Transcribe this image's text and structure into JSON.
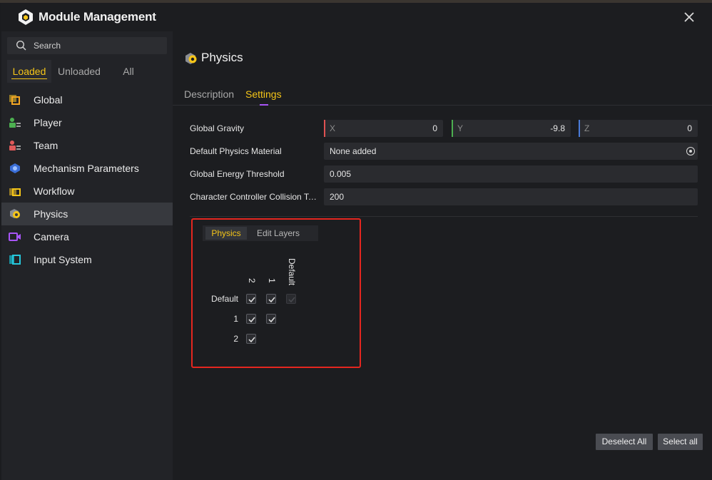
{
  "window": {
    "title": "Module Management",
    "icons": {
      "logo": "app-logo-icon",
      "close": "close-icon"
    }
  },
  "sidebar": {
    "search_placeholder": "Search",
    "filter_tabs": [
      {
        "label": "Loaded",
        "active": true
      },
      {
        "label": "Unloaded",
        "active": false
      },
      {
        "label": "All",
        "active": false
      }
    ],
    "modules": [
      {
        "label": "Global",
        "icon": "global-module-icon",
        "active": false
      },
      {
        "label": "Player",
        "icon": "player-module-icon",
        "active": false
      },
      {
        "label": "Team",
        "icon": "team-module-icon",
        "active": false
      },
      {
        "label": "Mechanism Parameters",
        "icon": "mechanism-module-icon",
        "active": false
      },
      {
        "label": "Workflow",
        "icon": "workflow-module-icon",
        "active": false
      },
      {
        "label": "Physics",
        "icon": "physics-module-icon",
        "active": true
      },
      {
        "label": "Camera",
        "icon": "camera-module-icon",
        "active": false
      },
      {
        "label": "Input System",
        "icon": "input-system-module-icon",
        "active": false
      }
    ]
  },
  "main": {
    "title": "Physics",
    "tabs": [
      {
        "label": "Description",
        "active": false
      },
      {
        "label": "Settings",
        "active": true
      }
    ],
    "settings": {
      "gravity": {
        "label": "Global Gravity",
        "x_placeholder": "X",
        "x": "0",
        "y_placeholder": "Y",
        "y": "-9.8",
        "z_placeholder": "Z",
        "z": "0"
      },
      "material": {
        "label": "Default Physics Material",
        "value": "None added"
      },
      "energy": {
        "label": "Global Energy Threshold",
        "value": "0.005"
      },
      "collision": {
        "label": "Character Controller Collision Tolerance",
        "value": "200"
      }
    },
    "matrix": {
      "tabs": [
        {
          "label": "Physics",
          "active": true
        },
        {
          "label": "Edit Layers",
          "active": false
        }
      ],
      "columns": [
        "2",
        "1",
        "Default"
      ],
      "rows": [
        {
          "label": "Default",
          "cells": [
            true,
            true,
            true
          ],
          "disabled": [
            false,
            false,
            true
          ]
        },
        {
          "label": "1",
          "cells": [
            true,
            true
          ]
        },
        {
          "label": "2",
          "cells": [
            true
          ]
        }
      ]
    },
    "buttons": {
      "deselect_all": "Deselect All",
      "select_all": "Select all"
    }
  },
  "colors": {
    "accent": "#f5c518",
    "tab_underline": "#a855f7",
    "highlight_border": "#e5261f",
    "axis_x": "#e05252",
    "axis_y": "#4caf50",
    "axis_z": "#4a7bd8"
  }
}
